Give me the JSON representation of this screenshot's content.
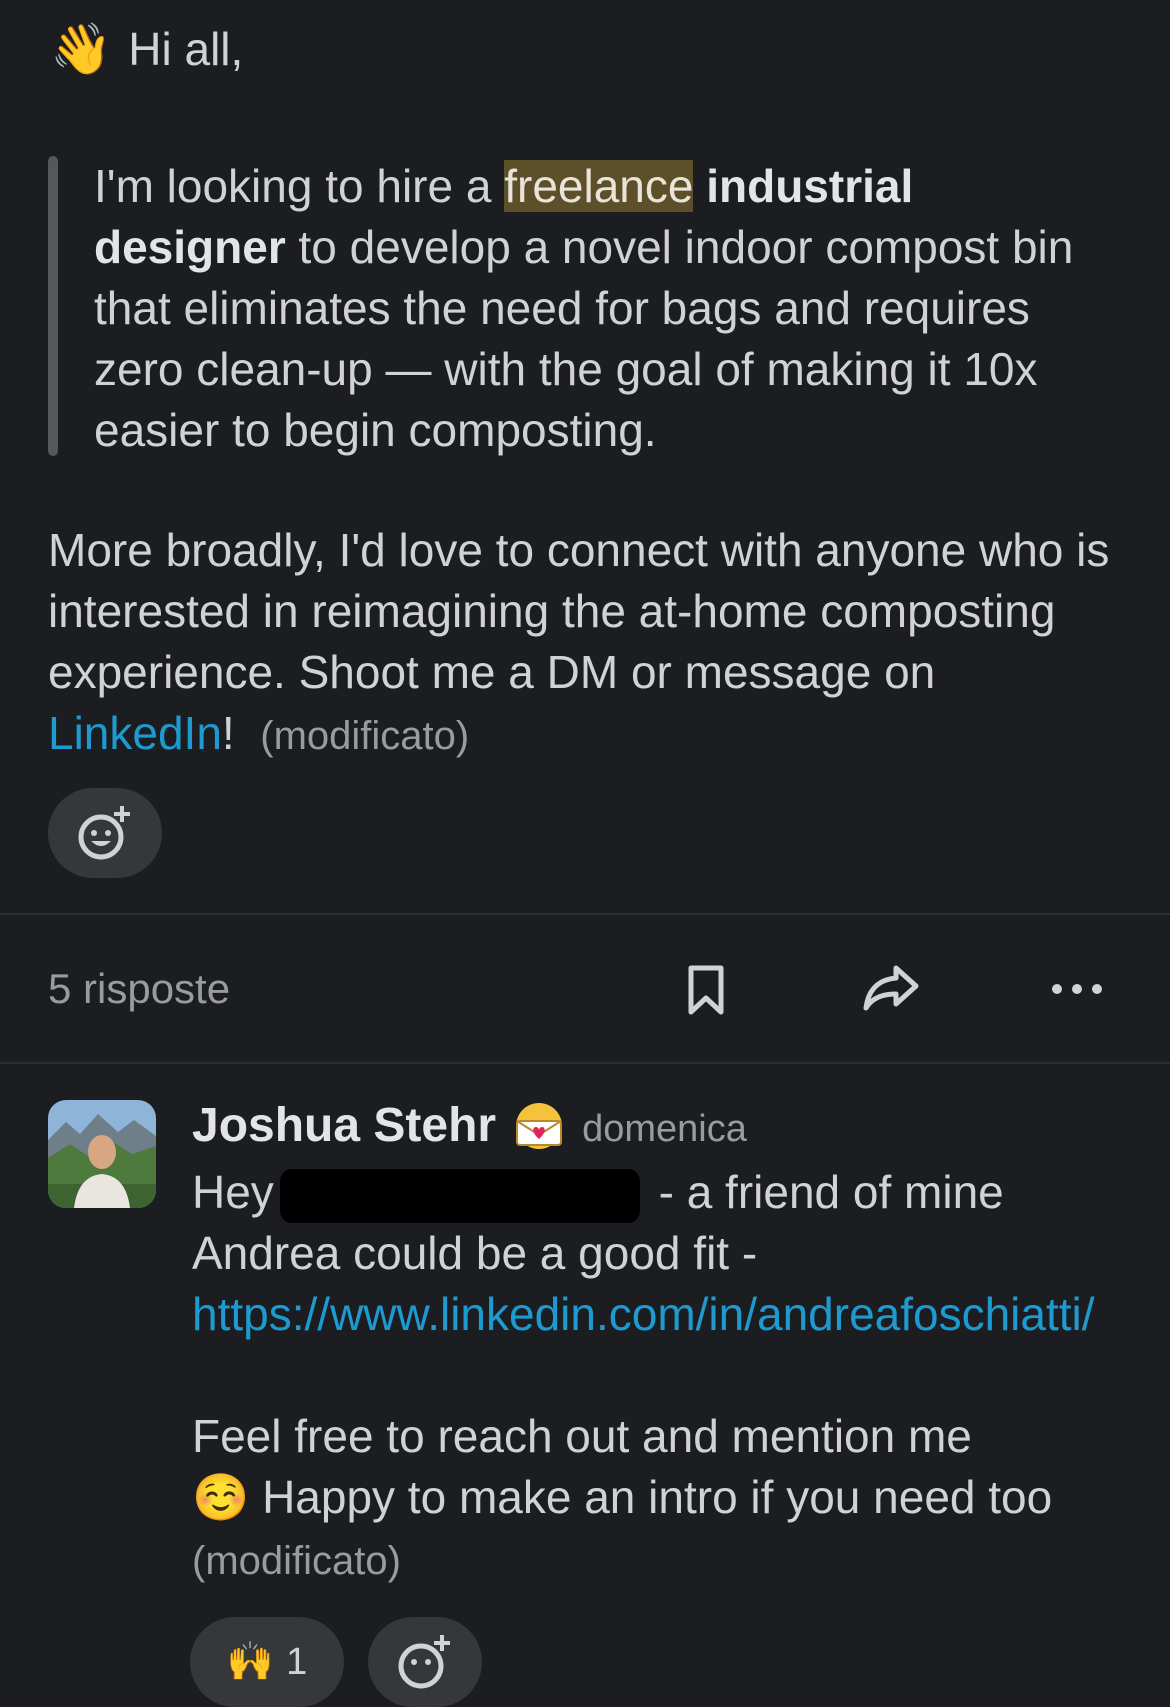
{
  "message": {
    "greeting_emoji": "👋",
    "greeting": "Hi all,",
    "quote": {
      "part1": "I'm looking to hire a ",
      "highlight": "freelance",
      "space": " ",
      "bold": "industrial designer",
      "part2": " to develop a novel indoor compost bin that eliminates the need for bags and requires zero clean-up — with the goal of making it 10x easier to begin composting."
    },
    "paragraph_text": "More broadly, I'd love to connect with anyone who is interested in reimagining the at-home composting experience. Shoot me a DM or message on ",
    "link_label": "LinkedIn",
    "after_link": "!",
    "edited_label": "(modificato)",
    "add_reaction_icon": "add-reaction-icon"
  },
  "thread_bar": {
    "replies_label": "5 risposte",
    "icons": [
      "bookmark-icon",
      "share-icon",
      "more-icon"
    ]
  },
  "reply": {
    "author": "Joshua Stehr",
    "status_emoji": "love-letter-emoji",
    "timestamp": "domenica",
    "line1_pre": "Hey",
    "line1_post": " - a friend of mine Andrea could be a good fit - ",
    "url": "https://www.linkedin.com/in/andreafoschiatti/",
    "line2": "Feel free to reach out and mention me",
    "smile_emoji": "☺️",
    "line3": "Happy to make an intro if you need too",
    "edited_label": "(modificato)",
    "reactions": [
      {
        "emoji": "🙌",
        "count": "1"
      }
    ]
  },
  "colors": {
    "background": "#1b1d21",
    "link": "#1d9bd1",
    "highlight": "#5c4f2a",
    "muted": "#9a9b9d"
  }
}
